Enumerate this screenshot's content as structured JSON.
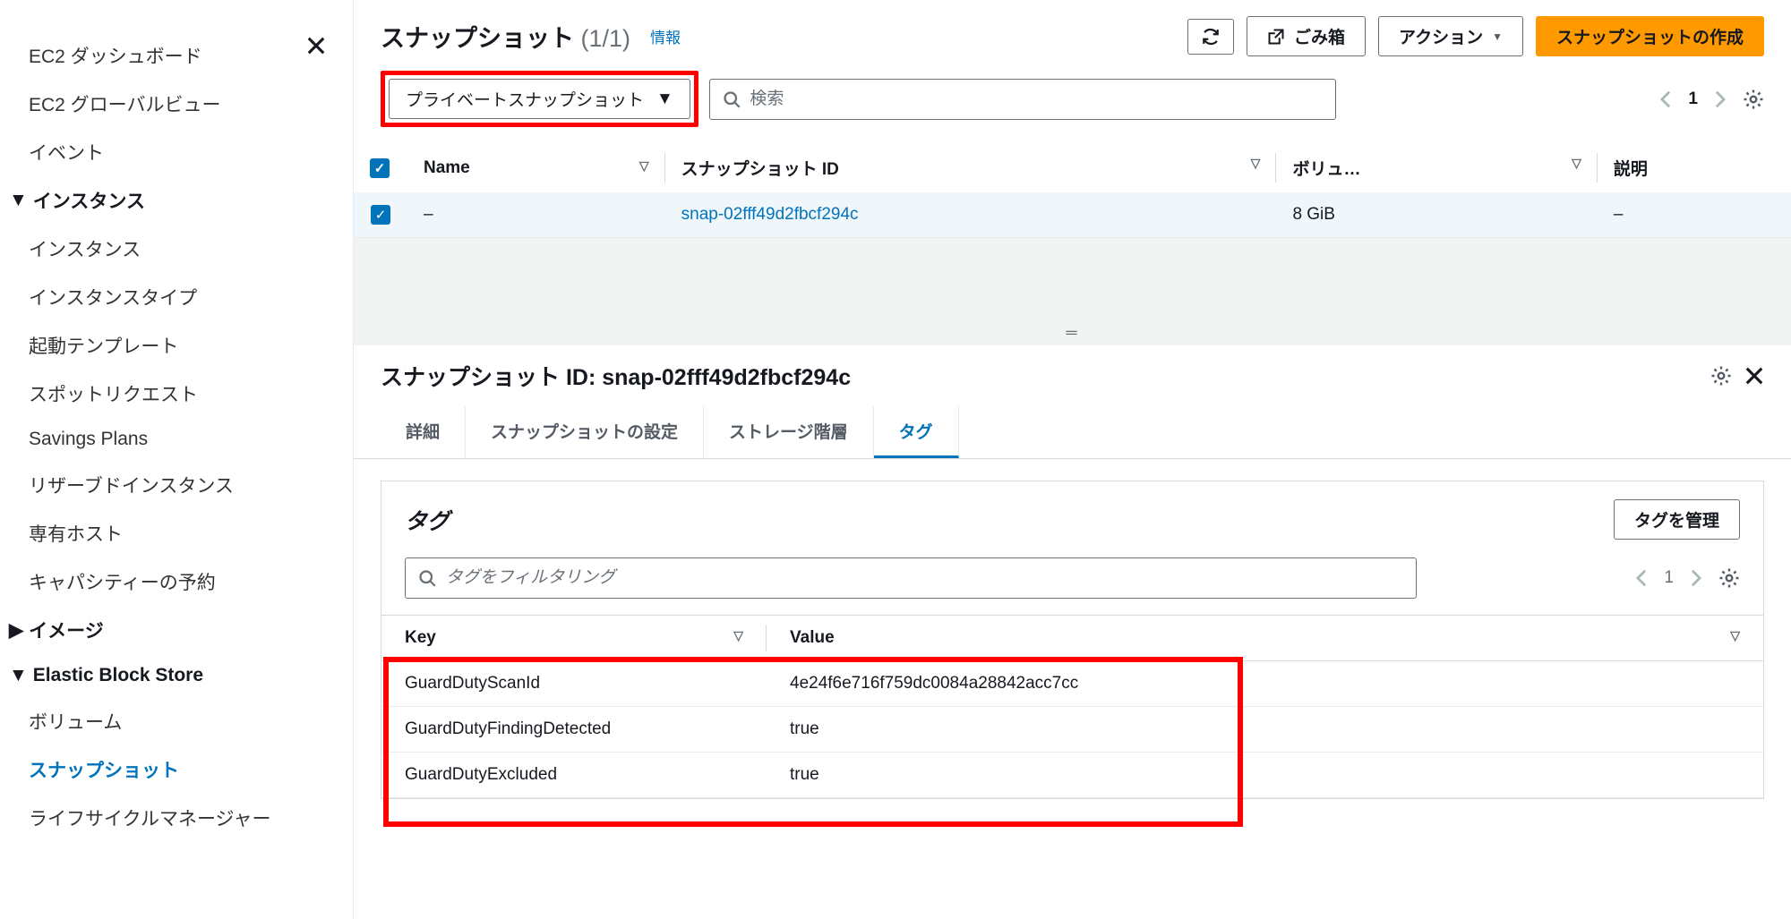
{
  "sidebar": {
    "top_items": [
      "EC2 ダッシュボード",
      "EC2 グローバルビュー",
      "イベント"
    ],
    "sections": [
      {
        "title": "インスタンス",
        "items": [
          "インスタンス",
          "インスタンスタイプ",
          "起動テンプレート",
          "スポットリクエスト",
          "Savings Plans",
          "リザーブドインスタンス",
          "専有ホスト",
          "キャパシティーの予約"
        ]
      },
      {
        "title": "イメージ",
        "items": []
      },
      {
        "title": "Elastic Block Store",
        "items": [
          "ボリューム",
          "スナップショット",
          "ライフサイクルマネージャー"
        ],
        "active_index": 1
      }
    ]
  },
  "header": {
    "title": "スナップショット",
    "count": "(1/1)",
    "info_link": "情報",
    "refresh_aria": "更新",
    "recycle_label": "ごみ箱",
    "actions_label": "アクション",
    "create_label": "スナップショットの作成"
  },
  "filter": {
    "dropdown_label": "プライベートスナップショット",
    "search_placeholder": "検索",
    "page": "1"
  },
  "table": {
    "columns": [
      "Name",
      "スナップショット ID",
      "ボリュ…",
      "説明"
    ],
    "row": {
      "name": "–",
      "snapshot_id": "snap-02fff49d2fbcf294c",
      "volume": "8 GiB",
      "description": "–"
    }
  },
  "details": {
    "title_prefix": "スナップショット ID: ",
    "snapshot_id": "snap-02fff49d2fbcf294c",
    "tabs": [
      "詳細",
      "スナップショットの設定",
      "ストレージ階層",
      "タグ"
    ],
    "active_tab": 3
  },
  "tags_card": {
    "title": "タグ",
    "manage_button": "タグを管理",
    "filter_placeholder": "タグをフィルタリング",
    "page": "1",
    "columns": {
      "key": "Key",
      "value": "Value"
    },
    "rows": [
      {
        "key": "GuardDutyScanId",
        "value": "4e24f6e716f759dc0084a28842acc7cc"
      },
      {
        "key": "GuardDutyFindingDetected",
        "value": "true"
      },
      {
        "key": "GuardDutyExcluded",
        "value": "true"
      }
    ]
  }
}
